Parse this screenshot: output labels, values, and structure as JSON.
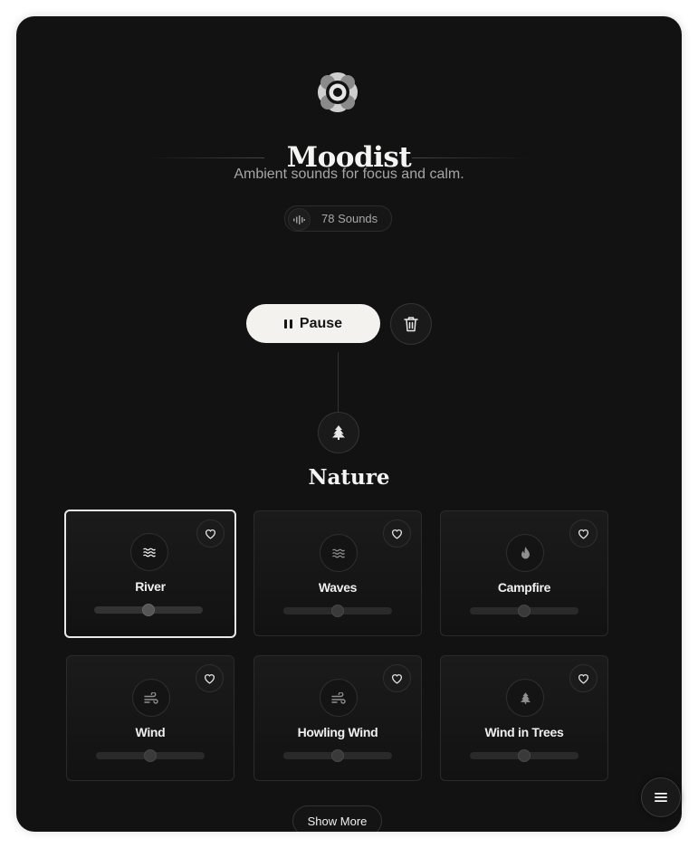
{
  "app": {
    "title": "Moodist",
    "subtitle": "Ambient sounds for focus and calm.",
    "sounds_count_label": "78 Sounds"
  },
  "controls": {
    "pause_label": "Pause",
    "clear_icon": "trash-icon"
  },
  "category": {
    "title": "Nature",
    "icon": "tree-icon",
    "sounds": [
      {
        "label": "River",
        "icon": "waves-icon",
        "selected": true,
        "volume": 0.5
      },
      {
        "label": "Waves",
        "icon": "waves-icon",
        "selected": false,
        "volume": 0.5
      },
      {
        "label": "Campfire",
        "icon": "fire-icon",
        "selected": false,
        "volume": 0.5
      },
      {
        "label": "Wind",
        "icon": "wind-icon",
        "selected": false,
        "volume": 0.5
      },
      {
        "label": "Howling Wind",
        "icon": "wind-icon",
        "selected": false,
        "volume": 0.5
      },
      {
        "label": "Wind in Trees",
        "icon": "tree-icon",
        "selected": false,
        "volume": 0.5
      }
    ]
  },
  "footer": {
    "show_more_label": "Show More",
    "menu_icon": "hamburger-menu-icon"
  },
  "colors": {
    "background": "#121212",
    "primary_button": "#f3f2ee",
    "text": "#f4f4f2",
    "muted_text": "#a6a6a6"
  }
}
